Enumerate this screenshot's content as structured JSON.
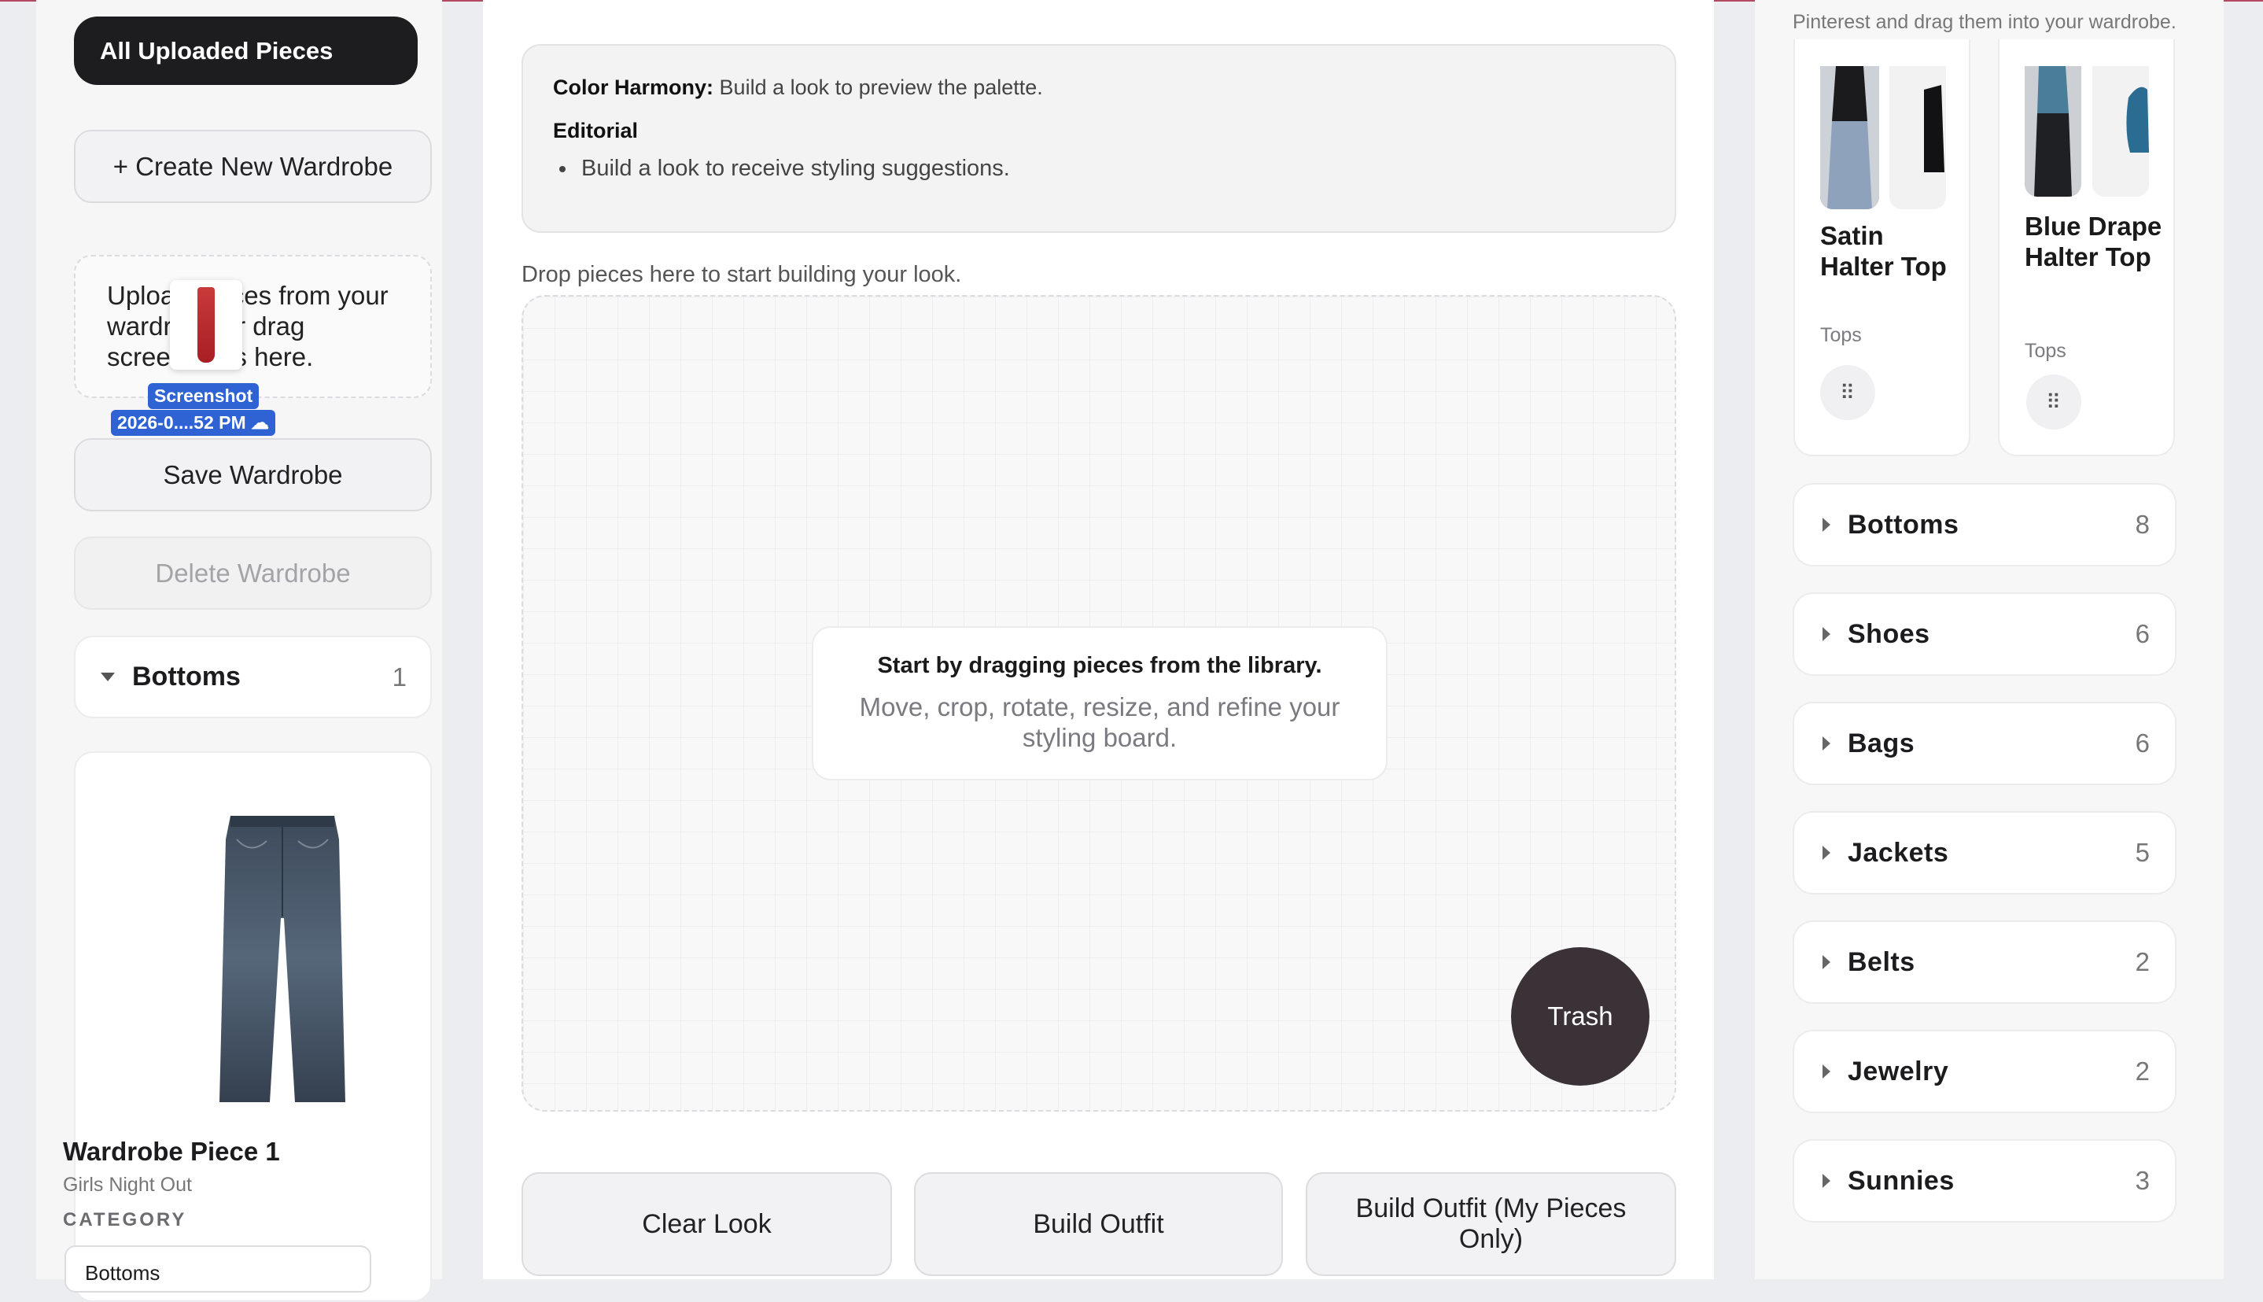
{
  "left": {
    "all_uploaded": "All Uploaded Pieces",
    "create_wardrobe": "+ Create New Wardrobe",
    "upload_text": "Upload pieces from your wardrobe or drag screenshots here.",
    "drag_badge_line1": "Screenshot",
    "drag_badge_line2": "2026-0....52 PM",
    "save_wardrobe": "Save Wardrobe",
    "delete_wardrobe": "Delete Wardrobe",
    "category": {
      "label": "Bottoms",
      "count": "1"
    },
    "piece": {
      "title": "Wardrobe Piece 1",
      "subtitle": "Girls Night Out",
      "category_label": "CATEGORY",
      "category_value": "Bottoms"
    }
  },
  "center": {
    "color_harmony_label": "Color Harmony:",
    "color_harmony_text": "Build a look to preview the palette.",
    "editorial_title": "Editorial",
    "editorial_item": "Build a look to receive styling suggestions.",
    "drop_hint": "Drop pieces here to start building your look.",
    "board_title": "Start by dragging pieces from the library.",
    "board_sub": "Move, crop, rotate, resize, and refine your styling board.",
    "trash": "Trash",
    "clear_look": "Clear Look",
    "build_outfit": "Build Outfit",
    "build_outfit_mine": "Build Outfit (My Pieces Only)"
  },
  "right": {
    "hint": "Pinterest and drag them into your wardrobe.",
    "products": [
      {
        "name": "Satin Halter Top",
        "type": "Tops"
      },
      {
        "name": "Blue Drape Halter Top",
        "type": "Tops"
      }
    ],
    "categories": [
      {
        "label": "Bottoms",
        "count": "8"
      },
      {
        "label": "Shoes",
        "count": "6"
      },
      {
        "label": "Bags",
        "count": "6"
      },
      {
        "label": "Jackets",
        "count": "5"
      },
      {
        "label": "Belts",
        "count": "2"
      },
      {
        "label": "Jewelry",
        "count": "2"
      },
      {
        "label": "Sunnies",
        "count": "3"
      }
    ]
  },
  "colors": {
    "dark_button": "#1d1d1f",
    "trash_button": "#3a3237",
    "drag_badge": "#2f63d3",
    "accent_line": "#b34a64"
  }
}
